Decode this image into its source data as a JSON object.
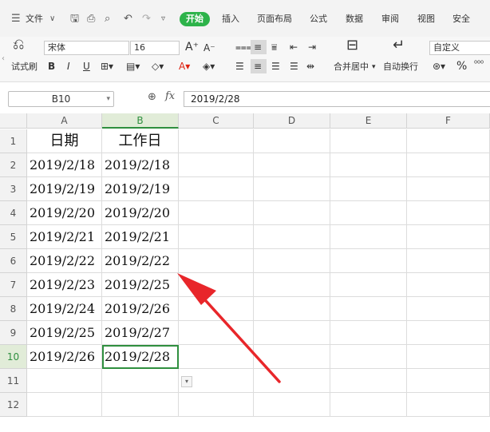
{
  "menu": {
    "file": "文件",
    "tabs": [
      "开始",
      "插入",
      "页面布局",
      "公式",
      "数据",
      "审阅",
      "视图",
      "安全"
    ]
  },
  "ribbon": {
    "clipboard_label": "试式刷",
    "font_name": "宋体",
    "font_size": "16",
    "merge_label": "合并居中",
    "wrap_label": "自动换行",
    "number_format": "自定义",
    "bold": "B",
    "italic": "I",
    "underline": "U",
    "percent": "%"
  },
  "formula_bar": {
    "name_box": "B10",
    "fx": "fx",
    "value": "2019/2/28"
  },
  "columns": [
    "A",
    "B",
    "C",
    "D",
    "E",
    "F"
  ],
  "rows": [
    "1",
    "2",
    "3",
    "4",
    "5",
    "6",
    "7",
    "8",
    "9",
    "10",
    "11",
    "12"
  ],
  "table": {
    "headers": [
      "日期",
      "工作日"
    ],
    "data": [
      [
        "2019/2/18",
        "2019/2/18"
      ],
      [
        "2019/2/19",
        "2019/2/19"
      ],
      [
        "2019/2/20",
        "2019/2/20"
      ],
      [
        "2019/2/21",
        "2019/2/21"
      ],
      [
        "2019/2/22",
        "2019/2/22"
      ],
      [
        "2019/2/23",
        "2019/2/25"
      ],
      [
        "2019/2/24",
        "2019/2/26"
      ],
      [
        "2019/2/25",
        "2019/2/27"
      ],
      [
        "2019/2/26",
        "2019/2/28"
      ]
    ]
  },
  "colors": {
    "accent": "#2db34a",
    "selection": "#2f8f3f",
    "arrow": "#e8262a"
  }
}
